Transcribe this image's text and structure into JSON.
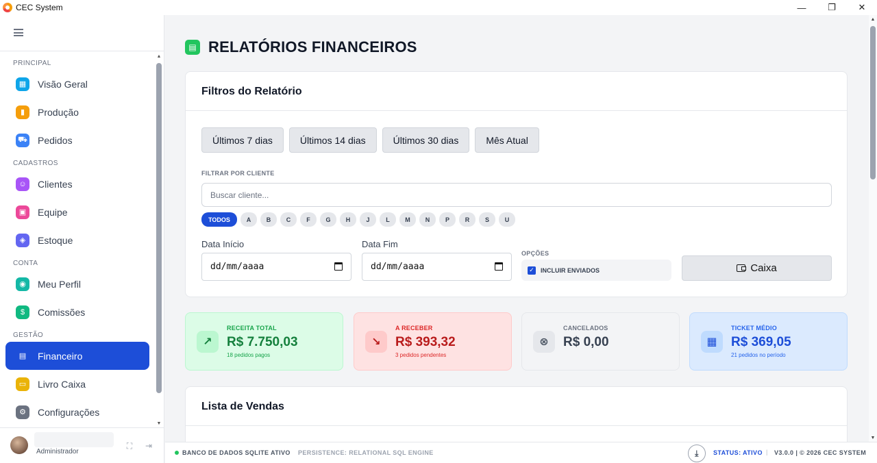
{
  "window": {
    "title": "CEC System",
    "controls": [
      "—",
      "❐",
      "✕"
    ]
  },
  "sidebar": {
    "sections": [
      {
        "title": "PRINCIPAL",
        "items": [
          {
            "label": "Visão Geral",
            "icon": "grid-icon",
            "color": "#0ea5e9",
            "glyph": "▦"
          },
          {
            "label": "Produção",
            "icon": "factory-icon",
            "color": "#f59e0b",
            "glyph": "▮"
          },
          {
            "label": "Pedidos",
            "icon": "cart-icon",
            "color": "#3b82f6",
            "glyph": "⛟"
          }
        ]
      },
      {
        "title": "CADASTROS",
        "items": [
          {
            "label": "Clientes",
            "icon": "users-icon",
            "color": "#a855f7",
            "glyph": "☺"
          },
          {
            "label": "Equipe",
            "icon": "briefcase-icon",
            "color": "#ec4899",
            "glyph": "▣"
          },
          {
            "label": "Estoque",
            "icon": "box-icon",
            "color": "#6366f1",
            "glyph": "◈"
          }
        ]
      },
      {
        "title": "CONTA",
        "items": [
          {
            "label": "Meu Perfil",
            "icon": "user-circle-icon",
            "color": "#14b8a6",
            "glyph": "◉"
          },
          {
            "label": "Comissões",
            "icon": "dollar-icon",
            "color": "#10b981",
            "glyph": "$"
          }
        ]
      },
      {
        "title": "GESTÃO",
        "items": [
          {
            "label": "Financeiro",
            "icon": "report-icon",
            "color": "#1d4ed8",
            "glyph": "▤",
            "active": true
          },
          {
            "label": "Livro Caixa",
            "icon": "wallet-icon",
            "color": "#eab308",
            "glyph": "▭"
          },
          {
            "label": "Configurações",
            "icon": "gear-icon",
            "color": "#6b7280",
            "glyph": "⚙"
          }
        ]
      }
    ],
    "user": {
      "role": "Administrador"
    }
  },
  "page": {
    "title": "RELATÓRIOS FINANCEIROS",
    "filters": {
      "title": "Filtros do Relatório",
      "quick_ranges": [
        "Últimos 7 dias",
        "Últimos 14 dias",
        "Últimos 30 dias",
        "Mês Atual"
      ],
      "client_label": "FILTRAR POR CLIENTE",
      "client_placeholder": "Buscar cliente...",
      "letters": [
        "TODOS",
        "A",
        "B",
        "C",
        "F",
        "G",
        "H",
        "J",
        "L",
        "M",
        "N",
        "P",
        "R",
        "S",
        "U"
      ],
      "start_label": "Data Início",
      "start_value": "dd/mm/aaaa",
      "end_label": "Data Fim",
      "end_value": "dd/mm/aaaa",
      "options_label": "OPÇÕES",
      "include_sent": "INCLUIR ENVIADOS",
      "include_sent_checked": true,
      "cash_button": "Caixa"
    },
    "stats": [
      {
        "label": "RECEITA TOTAL",
        "value": "R$ 7.750,03",
        "sub": "18 pedidos pagos",
        "glyph": "↗",
        "icon": "trend-up-icon"
      },
      {
        "label": "A RECEBER",
        "value": "R$ 393,32",
        "sub": "3 pedidos pendentes",
        "glyph": "↘",
        "icon": "trend-down-icon"
      },
      {
        "label": "CANCELADOS",
        "value": "R$ 0,00",
        "sub": "",
        "glyph": "⊗",
        "icon": "x-circle-icon"
      },
      {
        "label": "TICKET MÉDIO",
        "value": "R$ 369,05",
        "sub": "21 pedidos no período",
        "glyph": "▦",
        "icon": "calculator-icon"
      }
    ],
    "sales": {
      "title": "Lista de Vendas"
    }
  },
  "statusbar": {
    "db": "BANCO DE DADOS SQLITE ATIVO",
    "persistence": "PERSISTENCE: RELATIONAL SQL ENGINE",
    "status": "STATUS: ATIVO",
    "separator": "|",
    "version": "V3.0.0 | © 2026 CEC SYSTEM"
  }
}
